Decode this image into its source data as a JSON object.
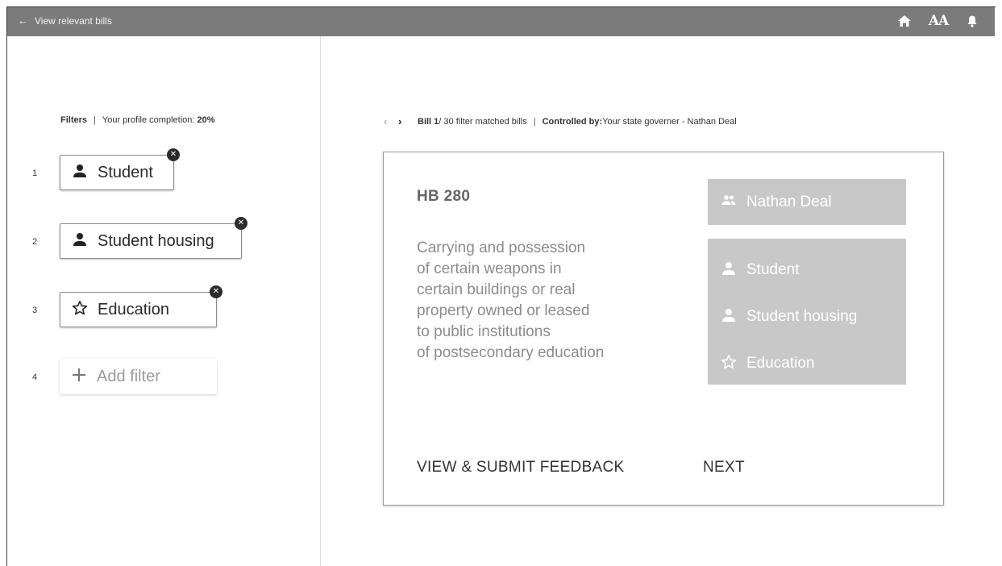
{
  "appbar": {
    "back_arrow": "←",
    "back_label": "View relevant bills",
    "icons": [
      "home-icon",
      "text-size-icon",
      "notification-bell-icon"
    ],
    "text_size_label": "AA"
  },
  "filters": {
    "title": "Filters",
    "separator": "|",
    "completion_label": "Your profile completion: ",
    "completion_value": "20%",
    "items": [
      {
        "num": "1",
        "label": "Student",
        "icon": "person-icon"
      },
      {
        "num": "2",
        "label": "Student housing",
        "icon": "person-icon"
      },
      {
        "num": "3",
        "label": "Education",
        "icon": "star-outline-icon"
      }
    ],
    "add": {
      "num": "4",
      "label": "Add filter",
      "icon": "plus-icon"
    }
  },
  "bill_nav": {
    "prev": "‹",
    "next": "›",
    "bill_label": "Bill 1",
    "bill_count": " / 30 filter matched bills",
    "separator": "|",
    "controlled_label": "Controlled by:",
    "controlled_value": " Your state governer - Nathan Deal"
  },
  "card": {
    "bill_id": "HB 280",
    "description_lines": [
      "Carrying and possession",
      "of certain weapons in",
      "certain buildings or real",
      "property owned or leased",
      "to public institutions",
      "of postsecondary education"
    ],
    "governor": {
      "name": "Nathan Deal",
      "icon": "people-icon"
    },
    "tags": [
      {
        "label": "Student",
        "icon": "person-icon"
      },
      {
        "label": "Student housing",
        "icon": "person-icon"
      },
      {
        "label": "Education",
        "icon": "star-outline-icon"
      }
    ],
    "feedback_button": "VIEW & SUBMIT FEEDBACK",
    "next_button": "NEXT"
  },
  "colors": {
    "appbar": "#7b7b7b",
    "tag_box": "#c8c8c8"
  }
}
